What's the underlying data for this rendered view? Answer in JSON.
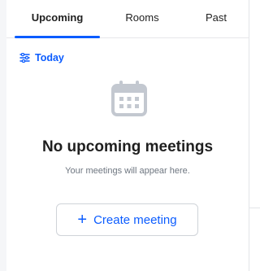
{
  "tabs": [
    {
      "label": "Upcoming",
      "active": true
    },
    {
      "label": "Rooms",
      "active": false
    },
    {
      "label": "Past",
      "active": false
    }
  ],
  "filter": {
    "label": "Today",
    "icon": "filter-icon"
  },
  "empty_state": {
    "icon": "calendar-icon",
    "title": "No upcoming meetings",
    "subtitle": "Your meetings will appear here."
  },
  "create_button": {
    "icon": "plus-icon",
    "icon_glyph": "+",
    "label": "Create meeting"
  },
  "colors": {
    "accent": "#0b5cff",
    "text_primary": "#1f1f1f",
    "text_secondary": "#6e7680",
    "icon_muted": "#c3c8d0"
  }
}
